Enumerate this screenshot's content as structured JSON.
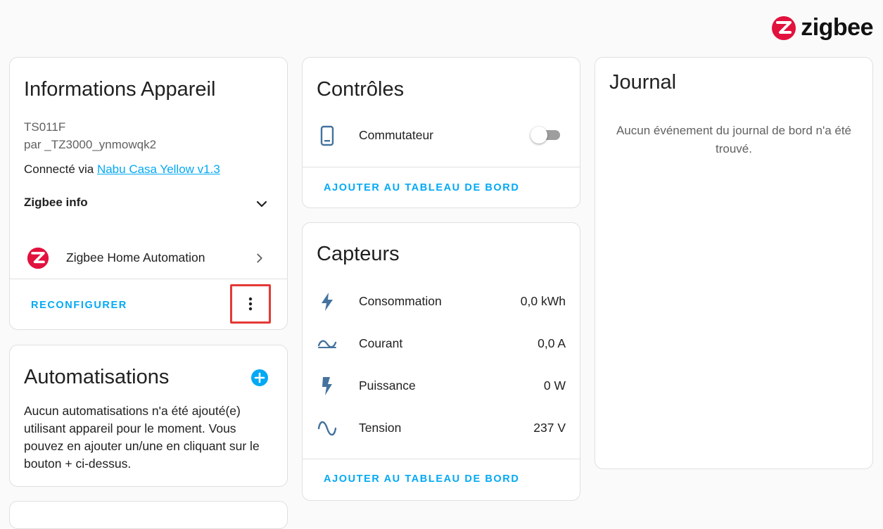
{
  "brand": {
    "name": "zigbee",
    "icon": "zigbee-logo-icon",
    "accent": "#e2113d"
  },
  "device_info": {
    "title": "Informations Appareil",
    "model": "TS011F",
    "manufacturer": "par _TZ3000_ynmowqk2",
    "connected_prefix": "Connecté via ",
    "connected_link": "Nabu Casa Yellow v1.3",
    "zigbee_info_label": "Zigbee info",
    "integration_label": "Zigbee Home Automation",
    "reconfigure_label": "RECONFIGURER"
  },
  "automations": {
    "title": "Automatisations",
    "empty_text": "Aucun automatisations n'a été ajouté(e) utilisant appareil pour le moment. Vous pouvez en ajouter un/une en cliquant sur le bouton + ci-dessus."
  },
  "controls": {
    "title": "Contrôles",
    "items": [
      {
        "label": "Commutateur",
        "icon": "smartphone-icon",
        "state": "off"
      }
    ],
    "add_label": "AJOUTER AU TABLEAU DE BORD"
  },
  "sensors": {
    "title": "Capteurs",
    "items": [
      {
        "label": "Consommation",
        "value": "0,0 kWh",
        "icon": "lightning-icon"
      },
      {
        "label": "Courant",
        "value": "0,0 A",
        "icon": "current-ac-icon"
      },
      {
        "label": "Puissance",
        "value": "0 W",
        "icon": "flash-icon"
      },
      {
        "label": "Tension",
        "value": "237 V",
        "icon": "sine-wave-icon"
      }
    ],
    "add_label": "AJOUTER AU TABLEAU DE BORD"
  },
  "journal": {
    "title": "Journal",
    "empty_text": "Aucun événement du journal de bord n'a été trouvé."
  },
  "colors": {
    "primary": "#03a9f4",
    "icon": "#44739e",
    "highlight": "#e53935"
  }
}
